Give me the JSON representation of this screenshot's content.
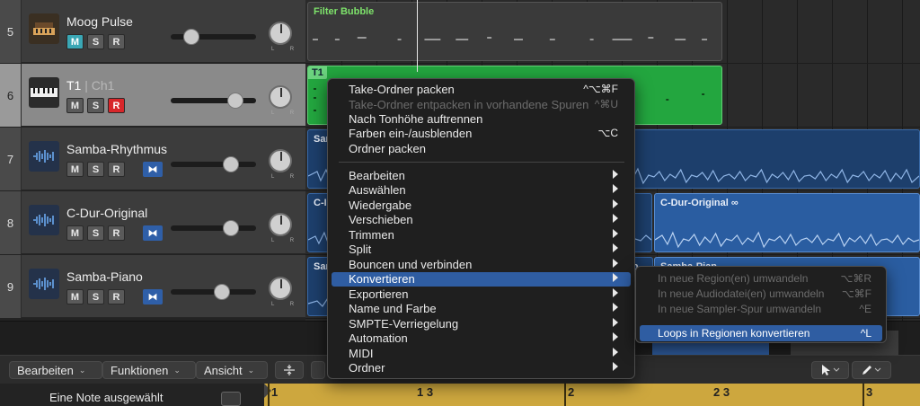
{
  "tracks": [
    {
      "number": "5",
      "name": "Moog Pulse",
      "name_sub": "",
      "icon": "synth-keyboard-icon",
      "mute_on": true,
      "rec_on": false,
      "flex": false
    },
    {
      "number": "6",
      "name": "T1",
      "name_sub": " | Ch1",
      "icon": "midi-keyboard-icon",
      "mute_on": false,
      "rec_on": true,
      "flex": false
    },
    {
      "number": "7",
      "name": "Samba-Rhythmus",
      "name_sub": "",
      "icon": "audio-waveform-icon",
      "mute_on": false,
      "rec_on": false,
      "flex": true
    },
    {
      "number": "8",
      "name": "C-Dur-Original",
      "name_sub": "",
      "icon": "audio-waveform-icon",
      "mute_on": false,
      "rec_on": false,
      "flex": true
    },
    {
      "number": "9",
      "name": "Samba-Piano",
      "name_sub": "",
      "icon": "audio-waveform-icon",
      "mute_on": false,
      "rec_on": false,
      "flex": true
    }
  ],
  "buttons": {
    "mute": "M",
    "solo": "S",
    "record": "R",
    "pan_lr": "L R",
    "flex": "⧓"
  },
  "regions": {
    "filter_bubble": "Filter Bubble",
    "t1": "T1",
    "samba_rhythm": "Sam",
    "c_dur_left": "C-I",
    "c_dur_right": "C-Dur-Original",
    "samba_piano_left": "Sam",
    "samba_piano_right_a": "mb",
    "samba_piano_right_b": "Samba-Pian"
  },
  "context_menu": {
    "items": [
      {
        "label": "Take-Ordner packen",
        "shortcut": "^⌥⌘F",
        "disabled": false,
        "submenu": false
      },
      {
        "label": "Take-Ordner entpacken in vorhandene Spuren",
        "shortcut": "^⌘U",
        "disabled": true,
        "submenu": false
      },
      {
        "label": "Nach Tonhöhe auftrennen",
        "shortcut": "",
        "disabled": false,
        "submenu": false
      },
      {
        "label": "Farben ein-/ausblenden",
        "shortcut": "⌥C",
        "disabled": false,
        "submenu": false
      },
      {
        "label": "Ordner packen",
        "shortcut": "",
        "disabled": false,
        "submenu": false
      },
      {
        "label": "Bearbeiten",
        "shortcut": "",
        "disabled": false,
        "submenu": true
      },
      {
        "label": "Auswählen",
        "shortcut": "",
        "disabled": false,
        "submenu": true
      },
      {
        "label": "Wiedergabe",
        "shortcut": "",
        "disabled": false,
        "submenu": true
      },
      {
        "label": "Verschieben",
        "shortcut": "",
        "disabled": false,
        "submenu": true
      },
      {
        "label": "Trimmen",
        "shortcut": "",
        "disabled": false,
        "submenu": true
      },
      {
        "label": "Split",
        "shortcut": "",
        "disabled": false,
        "submenu": true
      },
      {
        "label": "Bouncen und verbinden",
        "shortcut": "",
        "disabled": false,
        "submenu": true
      },
      {
        "label": "Konvertieren",
        "shortcut": "",
        "disabled": false,
        "submenu": true,
        "highlighted": true
      },
      {
        "label": "Exportieren",
        "shortcut": "",
        "disabled": false,
        "submenu": true
      },
      {
        "label": "Name und Farbe",
        "shortcut": "",
        "disabled": false,
        "submenu": true
      },
      {
        "label": "SMPTE-Verriegelung",
        "shortcut": "",
        "disabled": false,
        "submenu": true
      },
      {
        "label": "Automation",
        "shortcut": "",
        "disabled": false,
        "submenu": true
      },
      {
        "label": "MIDI",
        "shortcut": "",
        "disabled": false,
        "submenu": true
      },
      {
        "label": "Ordner",
        "shortcut": "",
        "disabled": false,
        "submenu": true
      }
    ]
  },
  "submenu": {
    "items": [
      {
        "label": "In neue Region(en) umwandeln",
        "shortcut": "⌥⌘R",
        "disabled": true
      },
      {
        "label": "In neue Audiodatei(en) umwandeln",
        "shortcut": "⌥⌘F",
        "disabled": true
      },
      {
        "label": "In neue Sampler-Spur umwandeln",
        "shortcut": "^E",
        "disabled": true
      },
      {
        "label": "Loops in Regionen konvertieren",
        "shortcut": "^L",
        "disabled": false,
        "highlighted": true
      }
    ]
  },
  "editor_toolbar": {
    "edit": "Bearbeiten",
    "functions": "Funktionen",
    "view": "Ansicht",
    "pointer_tool": "pointer-tool-icon",
    "pencil_tool": "pencil-tool-icon"
  },
  "editor": {
    "selection_label": "Eine Note ausgewählt"
  },
  "ruler": {
    "marks": [
      "1",
      "1 3",
      "2",
      "2 3",
      "3"
    ]
  },
  "colors": {
    "midi_region": "#23a63f",
    "audio_region": "#1d3f6c",
    "highlight": "#2f5da2",
    "ruler": "#cda73e",
    "record_on": "#d8262a",
    "mute_on": "#3aa7b5"
  }
}
